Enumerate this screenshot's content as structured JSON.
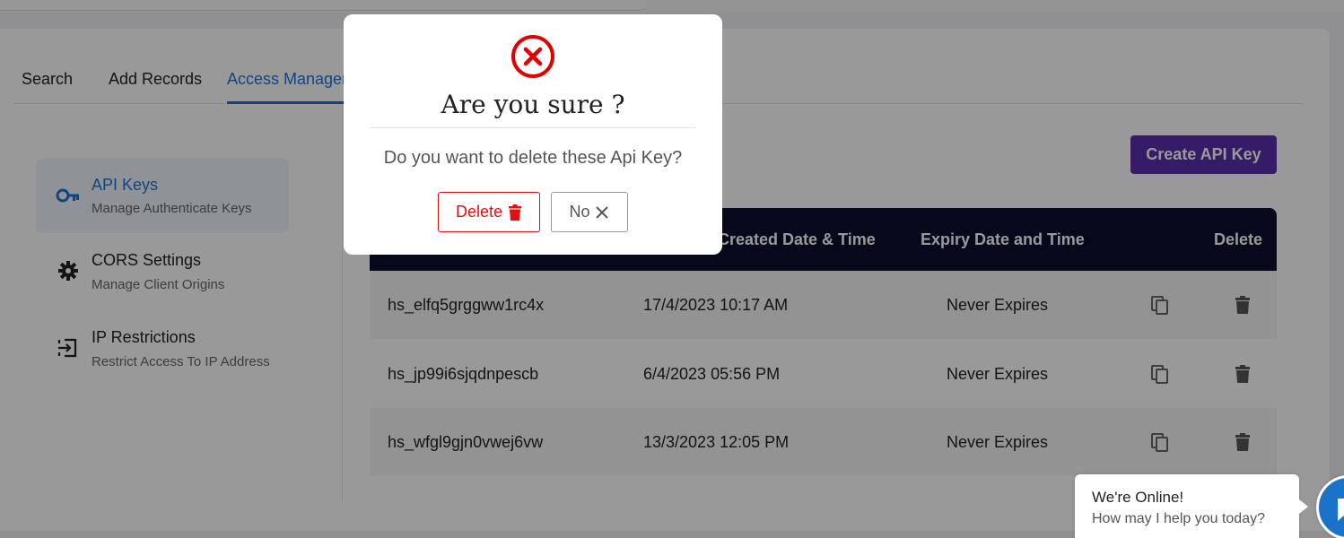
{
  "tabs": [
    {
      "label": "Search"
    },
    {
      "label": "Add Records"
    },
    {
      "label": "Access Management"
    }
  ],
  "sidebar": {
    "items": [
      {
        "title": "API Keys",
        "desc": "Manage Authenticate Keys",
        "icon": "key-icon"
      },
      {
        "title": "CORS Settings",
        "desc": "Manage Client Origins",
        "icon": "gear-icon"
      },
      {
        "title": "IP Restrictions",
        "desc": "Restrict Access To IP Address",
        "icon": "sign-in-icon"
      }
    ]
  },
  "create_button": {
    "label": "Create API Key"
  },
  "table": {
    "headers": [
      "Created Date & Time",
      "Expiry Date and Time",
      "Delete"
    ],
    "rows": [
      {
        "key": "hs_elfq5grggww1rc4x",
        "created": "17/4/2023 10:17 AM",
        "expiry": "Never Expires"
      },
      {
        "key": "hs_jp99i6sjqdnpescb",
        "created": "6/4/2023 05:56 PM",
        "expiry": "Never Expires"
      },
      {
        "key": "hs_wfgl9gjn0vwej6vw",
        "created": "13/3/2023 12:05 PM",
        "expiry": "Never Expires"
      }
    ]
  },
  "modal": {
    "title": "Are you sure ?",
    "message": "Do you want to delete these Api Key?",
    "delete_label": "Delete",
    "no_label": "No",
    "icon": "error-x-circle-icon"
  },
  "chat": {
    "line1": "We're Online!",
    "line2": "How may I help you today?"
  },
  "colors": {
    "accent": "#1f74d4",
    "primary_button": "#5a2fae",
    "table_header": "#0a0f2e",
    "danger": "#dd1111"
  }
}
